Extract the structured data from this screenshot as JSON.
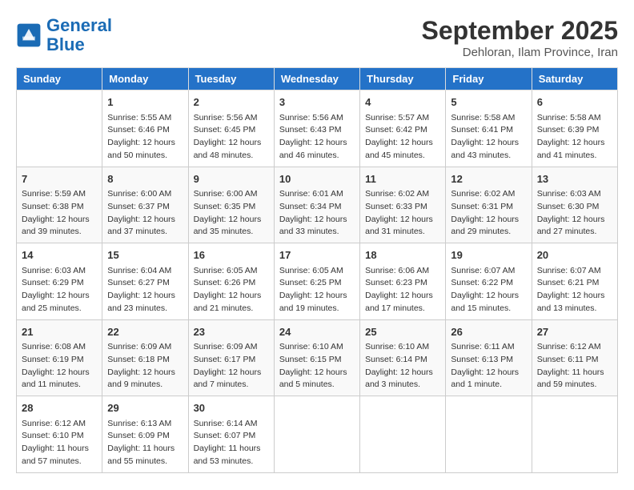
{
  "logo": {
    "line1": "General",
    "line2": "Blue"
  },
  "title": "September 2025",
  "subtitle": "Dehloran, Ilam Province, Iran",
  "days_of_week": [
    "Sunday",
    "Monday",
    "Tuesday",
    "Wednesday",
    "Thursday",
    "Friday",
    "Saturday"
  ],
  "weeks": [
    [
      {
        "num": "",
        "info": ""
      },
      {
        "num": "1",
        "info": "Sunrise: 5:55 AM\nSunset: 6:46 PM\nDaylight: 12 hours\nand 50 minutes."
      },
      {
        "num": "2",
        "info": "Sunrise: 5:56 AM\nSunset: 6:45 PM\nDaylight: 12 hours\nand 48 minutes."
      },
      {
        "num": "3",
        "info": "Sunrise: 5:56 AM\nSunset: 6:43 PM\nDaylight: 12 hours\nand 46 minutes."
      },
      {
        "num": "4",
        "info": "Sunrise: 5:57 AM\nSunset: 6:42 PM\nDaylight: 12 hours\nand 45 minutes."
      },
      {
        "num": "5",
        "info": "Sunrise: 5:58 AM\nSunset: 6:41 PM\nDaylight: 12 hours\nand 43 minutes."
      },
      {
        "num": "6",
        "info": "Sunrise: 5:58 AM\nSunset: 6:39 PM\nDaylight: 12 hours\nand 41 minutes."
      }
    ],
    [
      {
        "num": "7",
        "info": "Sunrise: 5:59 AM\nSunset: 6:38 PM\nDaylight: 12 hours\nand 39 minutes."
      },
      {
        "num": "8",
        "info": "Sunrise: 6:00 AM\nSunset: 6:37 PM\nDaylight: 12 hours\nand 37 minutes."
      },
      {
        "num": "9",
        "info": "Sunrise: 6:00 AM\nSunset: 6:35 PM\nDaylight: 12 hours\nand 35 minutes."
      },
      {
        "num": "10",
        "info": "Sunrise: 6:01 AM\nSunset: 6:34 PM\nDaylight: 12 hours\nand 33 minutes."
      },
      {
        "num": "11",
        "info": "Sunrise: 6:02 AM\nSunset: 6:33 PM\nDaylight: 12 hours\nand 31 minutes."
      },
      {
        "num": "12",
        "info": "Sunrise: 6:02 AM\nSunset: 6:31 PM\nDaylight: 12 hours\nand 29 minutes."
      },
      {
        "num": "13",
        "info": "Sunrise: 6:03 AM\nSunset: 6:30 PM\nDaylight: 12 hours\nand 27 minutes."
      }
    ],
    [
      {
        "num": "14",
        "info": "Sunrise: 6:03 AM\nSunset: 6:29 PM\nDaylight: 12 hours\nand 25 minutes."
      },
      {
        "num": "15",
        "info": "Sunrise: 6:04 AM\nSunset: 6:27 PM\nDaylight: 12 hours\nand 23 minutes."
      },
      {
        "num": "16",
        "info": "Sunrise: 6:05 AM\nSunset: 6:26 PM\nDaylight: 12 hours\nand 21 minutes."
      },
      {
        "num": "17",
        "info": "Sunrise: 6:05 AM\nSunset: 6:25 PM\nDaylight: 12 hours\nand 19 minutes."
      },
      {
        "num": "18",
        "info": "Sunrise: 6:06 AM\nSunset: 6:23 PM\nDaylight: 12 hours\nand 17 minutes."
      },
      {
        "num": "19",
        "info": "Sunrise: 6:07 AM\nSunset: 6:22 PM\nDaylight: 12 hours\nand 15 minutes."
      },
      {
        "num": "20",
        "info": "Sunrise: 6:07 AM\nSunset: 6:21 PM\nDaylight: 12 hours\nand 13 minutes."
      }
    ],
    [
      {
        "num": "21",
        "info": "Sunrise: 6:08 AM\nSunset: 6:19 PM\nDaylight: 12 hours\nand 11 minutes."
      },
      {
        "num": "22",
        "info": "Sunrise: 6:09 AM\nSunset: 6:18 PM\nDaylight: 12 hours\nand 9 minutes."
      },
      {
        "num": "23",
        "info": "Sunrise: 6:09 AM\nSunset: 6:17 PM\nDaylight: 12 hours\nand 7 minutes."
      },
      {
        "num": "24",
        "info": "Sunrise: 6:10 AM\nSunset: 6:15 PM\nDaylight: 12 hours\nand 5 minutes."
      },
      {
        "num": "25",
        "info": "Sunrise: 6:10 AM\nSunset: 6:14 PM\nDaylight: 12 hours\nand 3 minutes."
      },
      {
        "num": "26",
        "info": "Sunrise: 6:11 AM\nSunset: 6:13 PM\nDaylight: 12 hours\nand 1 minute."
      },
      {
        "num": "27",
        "info": "Sunrise: 6:12 AM\nSunset: 6:11 PM\nDaylight: 11 hours\nand 59 minutes."
      }
    ],
    [
      {
        "num": "28",
        "info": "Sunrise: 6:12 AM\nSunset: 6:10 PM\nDaylight: 11 hours\nand 57 minutes."
      },
      {
        "num": "29",
        "info": "Sunrise: 6:13 AM\nSunset: 6:09 PM\nDaylight: 11 hours\nand 55 minutes."
      },
      {
        "num": "30",
        "info": "Sunrise: 6:14 AM\nSunset: 6:07 PM\nDaylight: 11 hours\nand 53 minutes."
      },
      {
        "num": "",
        "info": ""
      },
      {
        "num": "",
        "info": ""
      },
      {
        "num": "",
        "info": ""
      },
      {
        "num": "",
        "info": ""
      }
    ]
  ]
}
